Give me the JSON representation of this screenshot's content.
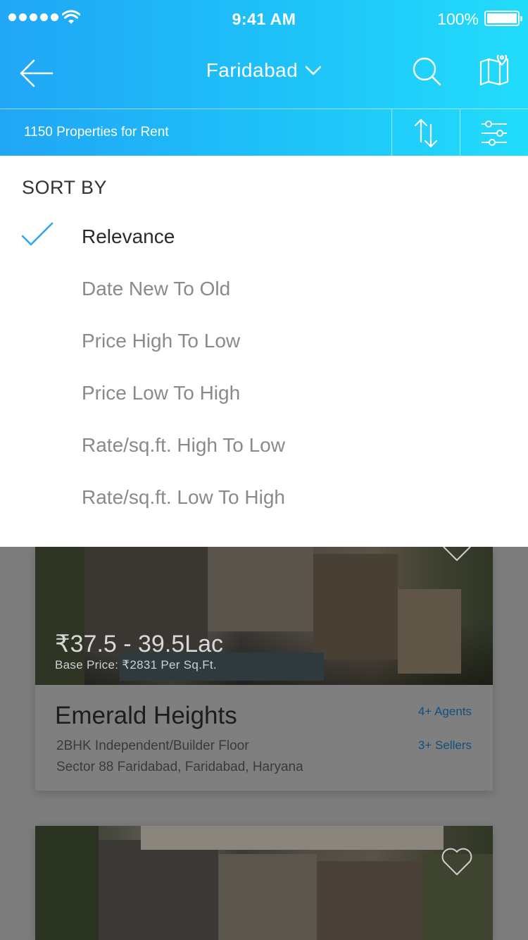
{
  "status_bar": {
    "time": "9:41 AM",
    "battery": "100%"
  },
  "header": {
    "city": "Faridabad",
    "count_text": "1150 Properties for Rent",
    "accent_color": "#1ec0f8"
  },
  "sort": {
    "title": "SORT BY",
    "options": [
      {
        "label": "Relevance",
        "selected": true
      },
      {
        "label": "Date New To Old",
        "selected": false
      },
      {
        "label": "Price High To Low",
        "selected": false
      },
      {
        "label": "Price Low To High",
        "selected": false
      },
      {
        "label": "Rate/sq.ft. High To Low",
        "selected": false
      },
      {
        "label": "Rate/sq.ft. Low To High",
        "selected": false
      }
    ],
    "check_color": "#29a9ef"
  },
  "listings": [
    {
      "price": "₹37.5 - 39.5Lac",
      "base_price": "Base Price:  ₹2831 Per Sq.Ft.",
      "name": "Emerald Heights",
      "type": "2BHK Independent/Builder Floor",
      "address": "Sector 88 Faridabad, Faridabad, Haryana",
      "agents": "4+ Agents",
      "sellers": "3+ Sellers"
    }
  ],
  "icons": {
    "back": "arrow-left-icon",
    "city_dropdown": "chevron-down-icon",
    "search": "search-icon",
    "map": "map-icon",
    "sort": "sort-arrows-icon",
    "filter": "sliders-icon",
    "check": "check-icon",
    "favorite": "heart-icon"
  }
}
